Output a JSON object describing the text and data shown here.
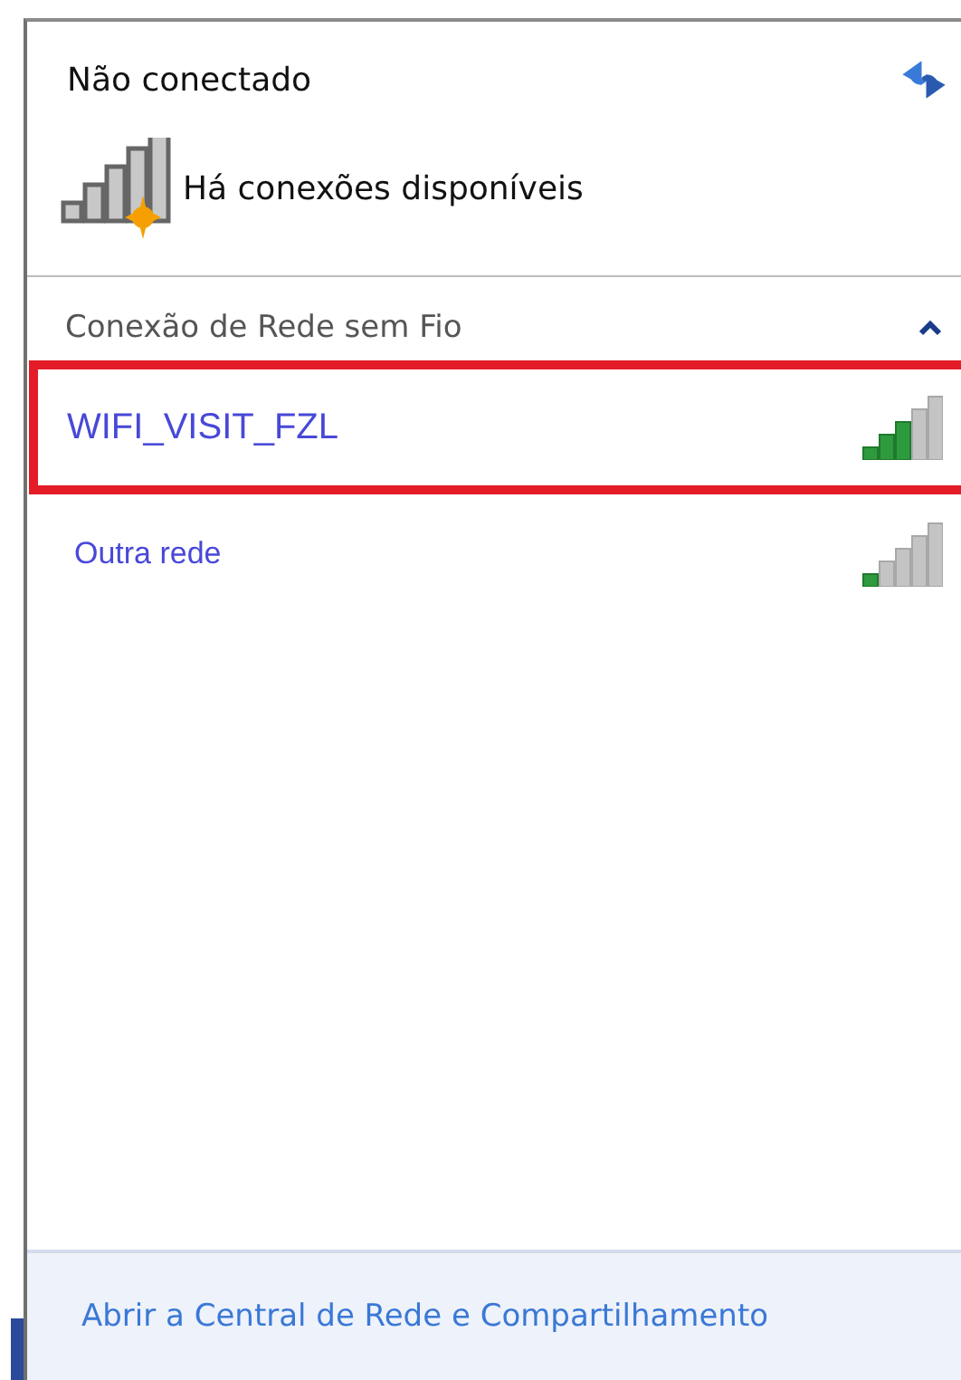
{
  "status": {
    "title": "Não conectado",
    "message": "Há conexões disponíveis"
  },
  "section": {
    "title": "Conexão de Rede sem Fio",
    "expanded": true
  },
  "networks": [
    {
      "name": "WIFI_VISIT_FZL",
      "highlighted": true
    },
    {
      "name": "Outra rede",
      "highlighted": false
    }
  ],
  "footer": {
    "link": "Abrir a Central de Rede e Compartilhamento"
  }
}
